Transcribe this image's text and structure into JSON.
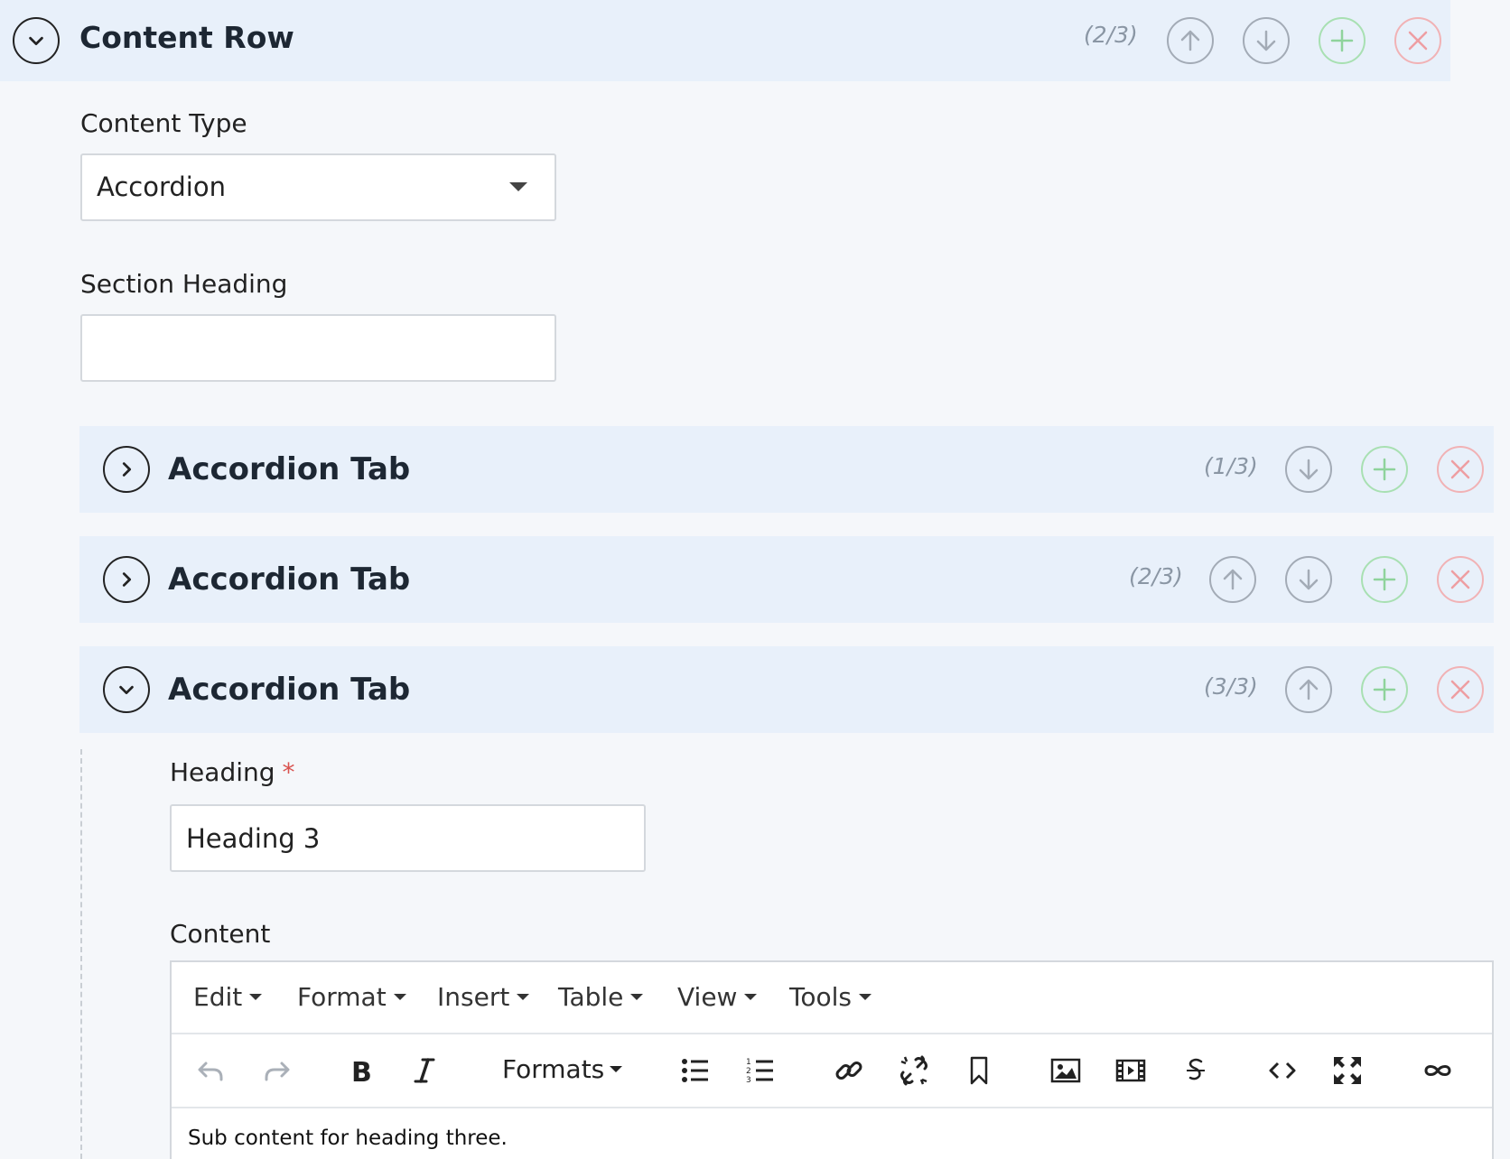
{
  "content_row": {
    "title": "Content Row",
    "counter": "(2/3)"
  },
  "content_type": {
    "label": "Content Type",
    "value": "Accordion"
  },
  "section_heading": {
    "label": "Section Heading",
    "value": "",
    "placeholder": ""
  },
  "accordion_tabs": [
    {
      "title": "Accordion Tab",
      "counter": "(1/3)"
    },
    {
      "title": "Accordion Tab",
      "counter": "(2/3)"
    },
    {
      "title": "Accordion Tab",
      "counter": "(3/3)"
    }
  ],
  "heading_field": {
    "label": "Heading",
    "required_mark": "*",
    "value": "Heading 3"
  },
  "content_field": {
    "label": "Content"
  },
  "editor": {
    "menus": [
      "Edit",
      "Format",
      "Insert",
      "Table",
      "View",
      "Tools"
    ],
    "formats_label": "Formats",
    "body": "Sub content for heading three.",
    "toolbar_icons": [
      "undo-icon",
      "redo-icon",
      "bold-icon",
      "italic-icon",
      "bullet-list-icon",
      "numbered-list-icon",
      "link-icon",
      "unlink-icon",
      "bookmark-icon",
      "image-icon",
      "video-icon",
      "strikethrough-icon",
      "code-icon",
      "fullscreen-icon",
      "infinity-icon"
    ]
  },
  "colors": {
    "header_bg": "#e8f0fa",
    "page_bg": "#f5f7fa",
    "move_button": "#a3abb6",
    "add_button": "#a8e0b2",
    "remove_button": "#f1b2b5",
    "required": "#d9534f"
  }
}
